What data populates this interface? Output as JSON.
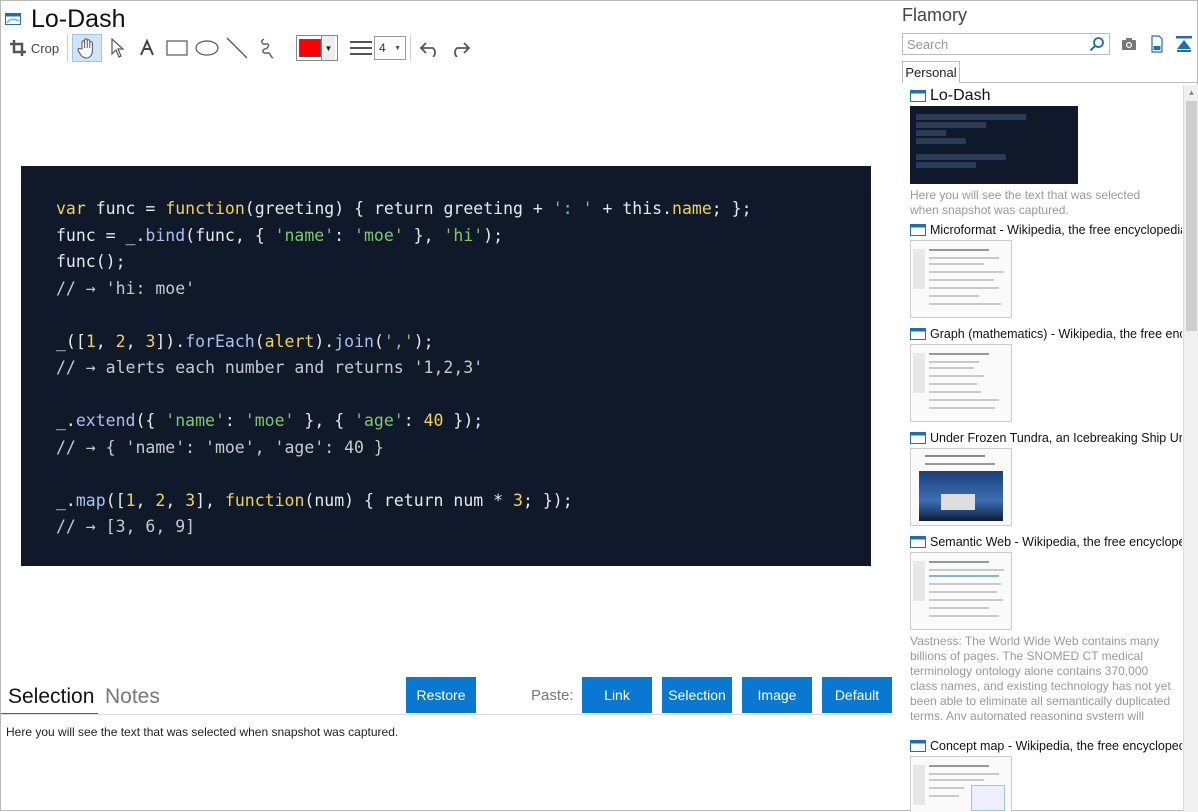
{
  "app": {
    "title": "Lo-Dash"
  },
  "toolbar": {
    "crop_label": "Crop",
    "color": "#ff0000",
    "line_width": "4"
  },
  "code_lines": [
    [
      [
        "var ",
        "kw"
      ],
      [
        "func",
        "pl"
      ],
      [
        " = ",
        "pl"
      ],
      [
        "function",
        "kw"
      ],
      [
        "(greeting) { ",
        "pl"
      ],
      [
        "return",
        "pl"
      ],
      [
        " greeting + ",
        "pl"
      ],
      [
        "': '",
        "str"
      ],
      [
        " + ",
        "pl"
      ],
      [
        "this",
        "pl"
      ],
      [
        ".",
        "pl"
      ],
      [
        "name",
        "kw"
      ],
      [
        "; };",
        "pl"
      ]
    ],
    [
      [
        "func = _.",
        "pl"
      ],
      [
        "bind",
        "fn"
      ],
      [
        "(func, { ",
        "pl"
      ],
      [
        "'name'",
        "str"
      ],
      [
        ": ",
        "pl"
      ],
      [
        "'moe'",
        "str"
      ],
      [
        " }, ",
        "pl"
      ],
      [
        "'hi'",
        "str"
      ],
      [
        ");",
        "pl"
      ]
    ],
    [
      [
        "func();",
        "pl"
      ]
    ],
    [
      [
        "// → 'hi: moe'",
        "cm"
      ]
    ],
    [
      [
        "",
        "pl"
      ]
    ],
    [
      [
        "_([",
        "pl"
      ],
      [
        "1",
        "num"
      ],
      [
        ", ",
        "pl"
      ],
      [
        "2",
        "num"
      ],
      [
        ", ",
        "pl"
      ],
      [
        "3",
        "num"
      ],
      [
        "]).",
        "pl"
      ],
      [
        "forEach",
        "fn"
      ],
      [
        "(",
        "pl"
      ],
      [
        "alert",
        "kw"
      ],
      [
        ").",
        "pl"
      ],
      [
        "join",
        "fn"
      ],
      [
        "(",
        "pl"
      ],
      [
        "','",
        "str"
      ],
      [
        ");",
        "pl"
      ]
    ],
    [
      [
        "// → alerts each number and returns '1,2,3'",
        "cm"
      ]
    ],
    [
      [
        "",
        "pl"
      ]
    ],
    [
      [
        "_.",
        "pl"
      ],
      [
        "extend",
        "fn"
      ],
      [
        "({ ",
        "pl"
      ],
      [
        "'name'",
        "str"
      ],
      [
        ": ",
        "pl"
      ],
      [
        "'moe'",
        "str"
      ],
      [
        " }, { ",
        "pl"
      ],
      [
        "'age'",
        "str"
      ],
      [
        ": ",
        "pl"
      ],
      [
        "40",
        "num"
      ],
      [
        " });",
        "pl"
      ]
    ],
    [
      [
        "// → { 'name': 'moe', 'age': 40 }",
        "cm"
      ]
    ],
    [
      [
        "",
        "pl"
      ]
    ],
    [
      [
        "_.",
        "pl"
      ],
      [
        "map",
        "fn"
      ],
      [
        "([",
        "pl"
      ],
      [
        "1",
        "num"
      ],
      [
        ", ",
        "pl"
      ],
      [
        "2",
        "num"
      ],
      [
        ", ",
        "pl"
      ],
      [
        "3",
        "num"
      ],
      [
        "], ",
        "pl"
      ],
      [
        "function",
        "kw"
      ],
      [
        "(num) { return num * ",
        "pl"
      ],
      [
        "3",
        "num"
      ],
      [
        "; });",
        "pl"
      ]
    ],
    [
      [
        "// → [3, 6, 9]",
        "cm"
      ]
    ]
  ],
  "bottom": {
    "tab_selection": "Selection",
    "tab_notes": "Notes",
    "restore": "Restore",
    "paste_label": "Paste:",
    "link": "Link",
    "selection": "Selection",
    "image": "Image",
    "default": "Default",
    "selected_text": "Here you will see the text that was selected when snapshot was captured."
  },
  "sidebar": {
    "title": "Flamory",
    "search_placeholder": "Search",
    "tab": "Personal",
    "items": [
      {
        "title": "Lo-Dash",
        "desc": "Here you will see the text that was selected when snapshot was captured."
      },
      {
        "title": "Microformat - Wikipedia, the free encyclopedia"
      },
      {
        "title": "Graph (mathematics) - Wikipedia, the free encyc"
      },
      {
        "title": "Under Frozen Tundra, an Icebreaking Ship Unco"
      },
      {
        "title": "Semantic Web - Wikipedia, the free encycloped",
        "desc": "Vastness: The World Wide Web contains many billions of pages. The SNOMED CT medical terminology ontology alone contains 370,000 class names, and existing technology has not yet been able to eliminate all semantically duplicated terms. Any automated reasoning system will have to deal with truly huge inputs."
      },
      {
        "title": "Concept map - Wikipedia, the free encyclopedi"
      }
    ]
  },
  "colors": {
    "accent": "#0a78d0",
    "code_bg": "#0f192a"
  }
}
